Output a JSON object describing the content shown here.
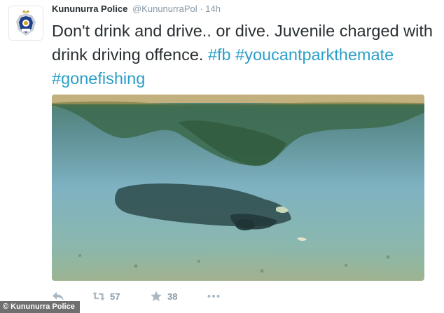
{
  "tweet": {
    "display_name": "Kununurra Police",
    "handle": "@KununurraPol",
    "separator": "·",
    "time": "14h",
    "text_plain": "Don't drink and drive.. or dive. Juvenile charged with drink driving offence. ",
    "hashtags": [
      "#fb",
      "#youcantparkthemate",
      "#gonefishing"
    ],
    "avatar": {
      "icon": "police-badge-icon",
      "badge_text": "POLICE"
    },
    "photo": {
      "subject": "submerged-car-in-river"
    }
  },
  "actions": {
    "reply_icon": "reply-icon",
    "retweet_icon": "retweet-icon",
    "retweet_count": "57",
    "favorite_icon": "star-icon",
    "favorite_count": "38",
    "more_icon": "more-icon"
  },
  "watermark": {
    "text": "© Kununurra Police"
  },
  "colors": {
    "hashtag": "#2b9fc7",
    "action_icon": "#aab8c2",
    "secondary_text": "#8899a6",
    "primary_text": "#292f33"
  }
}
